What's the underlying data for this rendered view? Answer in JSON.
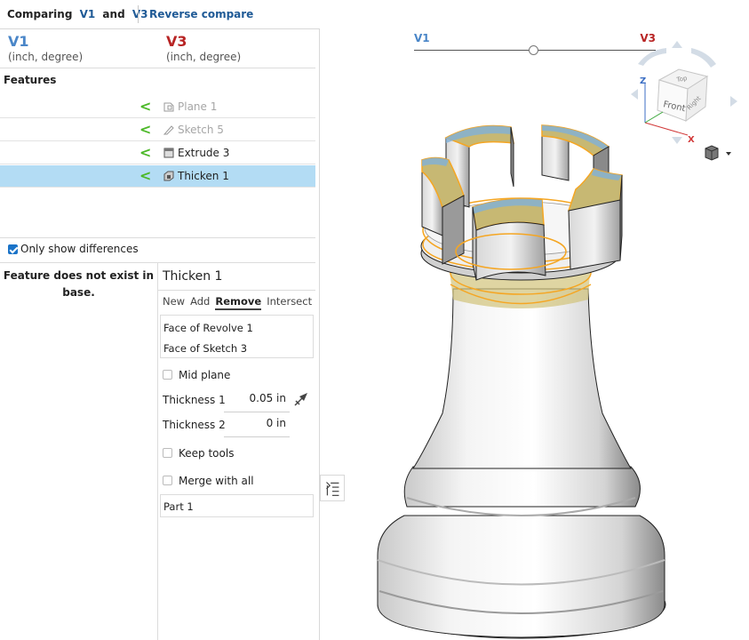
{
  "header": {
    "comparing_prefix": "Comparing",
    "left_version": "V1",
    "and_word": "and",
    "right_version": "V3",
    "reverse_compare": "Reverse compare"
  },
  "versions": {
    "left": {
      "name": "V1",
      "units": "(inch, degree)",
      "color": "#4a86c8"
    },
    "right": {
      "name": "V3",
      "units": "(inch, degree)",
      "color": "#b82525"
    }
  },
  "features": {
    "title": "Features",
    "items": [
      {
        "label": "Plane 1",
        "icon": "plane-icon",
        "dimmed": true
      },
      {
        "label": "Sketch 5",
        "icon": "sketch-icon",
        "dimmed": true
      },
      {
        "label": "Extrude 3",
        "icon": "extrude-icon",
        "dimmed": false
      },
      {
        "label": "Thicken 1",
        "icon": "thicken-icon",
        "dimmed": false,
        "selected": true
      }
    ],
    "arrow_glyph": "<",
    "arrow_color": "#4cb828"
  },
  "only_differences": {
    "label": "Only show differences",
    "checked": true
  },
  "base_message": "Feature does not exist in base.",
  "detail": {
    "title": "Thicken 1",
    "tabs": [
      "New",
      "Add",
      "Remove",
      "Intersect"
    ],
    "active_tab": "Remove",
    "faces": [
      "Face of Revolve 1",
      "Face of Sketch 3"
    ],
    "mid_plane": "Mid plane",
    "thickness1_label": "Thickness 1",
    "thickness1_value": "0.05 in",
    "thickness2_label": "Thickness 2",
    "thickness2_value": "0 in",
    "keep_tools": "Keep tools",
    "merge_with_all": "Merge with all",
    "part": "Part 1"
  },
  "viewport": {
    "slider_left": "V1",
    "slider_right": "V3",
    "slider_position": 0.49,
    "cube_labels": {
      "top": "Top",
      "front": "Front",
      "right": "Right",
      "z": "Z",
      "x": "X"
    },
    "highlight_color": "#f5a623"
  }
}
